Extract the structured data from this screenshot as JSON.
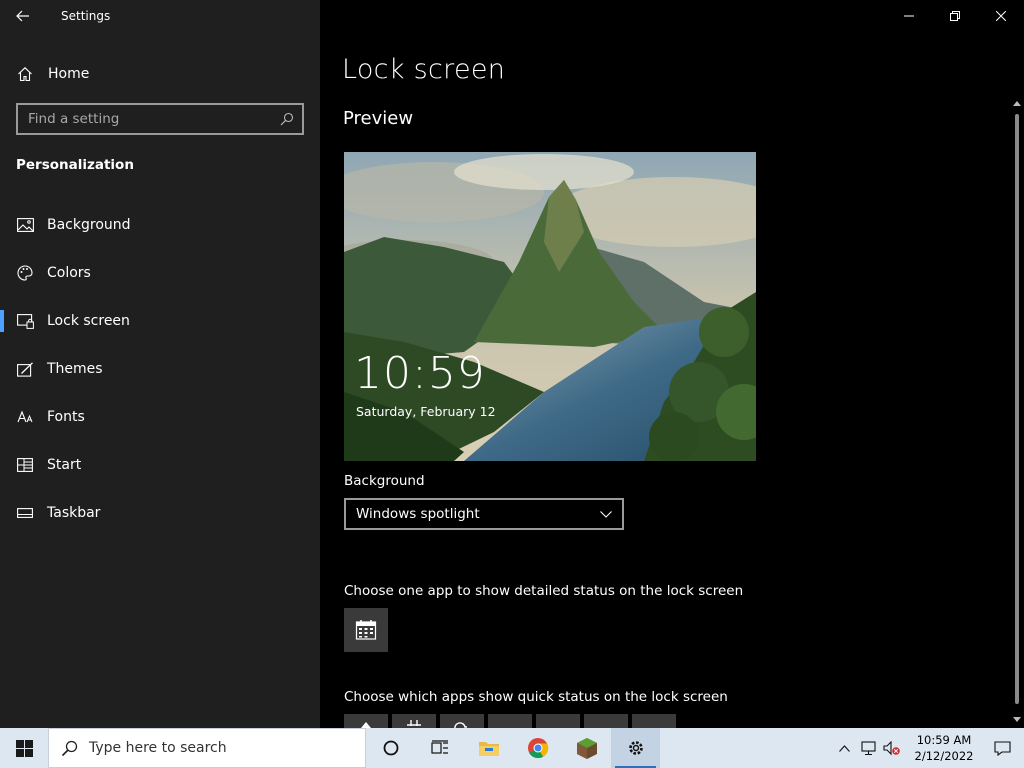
{
  "window": {
    "title": "Settings"
  },
  "sidebar": {
    "home_label": "Home",
    "search_placeholder": "Find a setting",
    "section": "Personalization",
    "items": [
      {
        "label": "Background",
        "icon": "image-icon"
      },
      {
        "label": "Colors",
        "icon": "palette-icon"
      },
      {
        "label": "Lock screen",
        "icon": "lock-screen-icon",
        "active": true
      },
      {
        "label": "Themes",
        "icon": "themes-icon"
      },
      {
        "label": "Fonts",
        "icon": "fonts-icon"
      },
      {
        "label": "Start",
        "icon": "start-icon"
      },
      {
        "label": "Taskbar",
        "icon": "taskbar-icon"
      }
    ]
  },
  "main": {
    "title": "Lock screen",
    "preview_heading": "Preview",
    "preview_time": "10:59",
    "preview_date": "Saturday, February 12",
    "background_label": "Background",
    "background_value": "Windows spotlight",
    "detail_status_label": "Choose one app to show detailed status on the lock screen",
    "quick_status_label": "Choose which apps show quick status on the lock screen"
  },
  "taskbar": {
    "search_placeholder": "Type here to search",
    "clock_time": "10:59 AM",
    "clock_date": "2/12/2022",
    "apps": [
      "cortana-icon",
      "task-view-icon",
      "file-explorer-icon",
      "chrome-icon",
      "minecraft-icon",
      "settings-icon"
    ]
  },
  "colors": {
    "sidebar_bg": "#1f1f1f",
    "main_bg": "#000000",
    "accent": "#4fa1ff",
    "taskbar_bg": "#dde7f1"
  }
}
